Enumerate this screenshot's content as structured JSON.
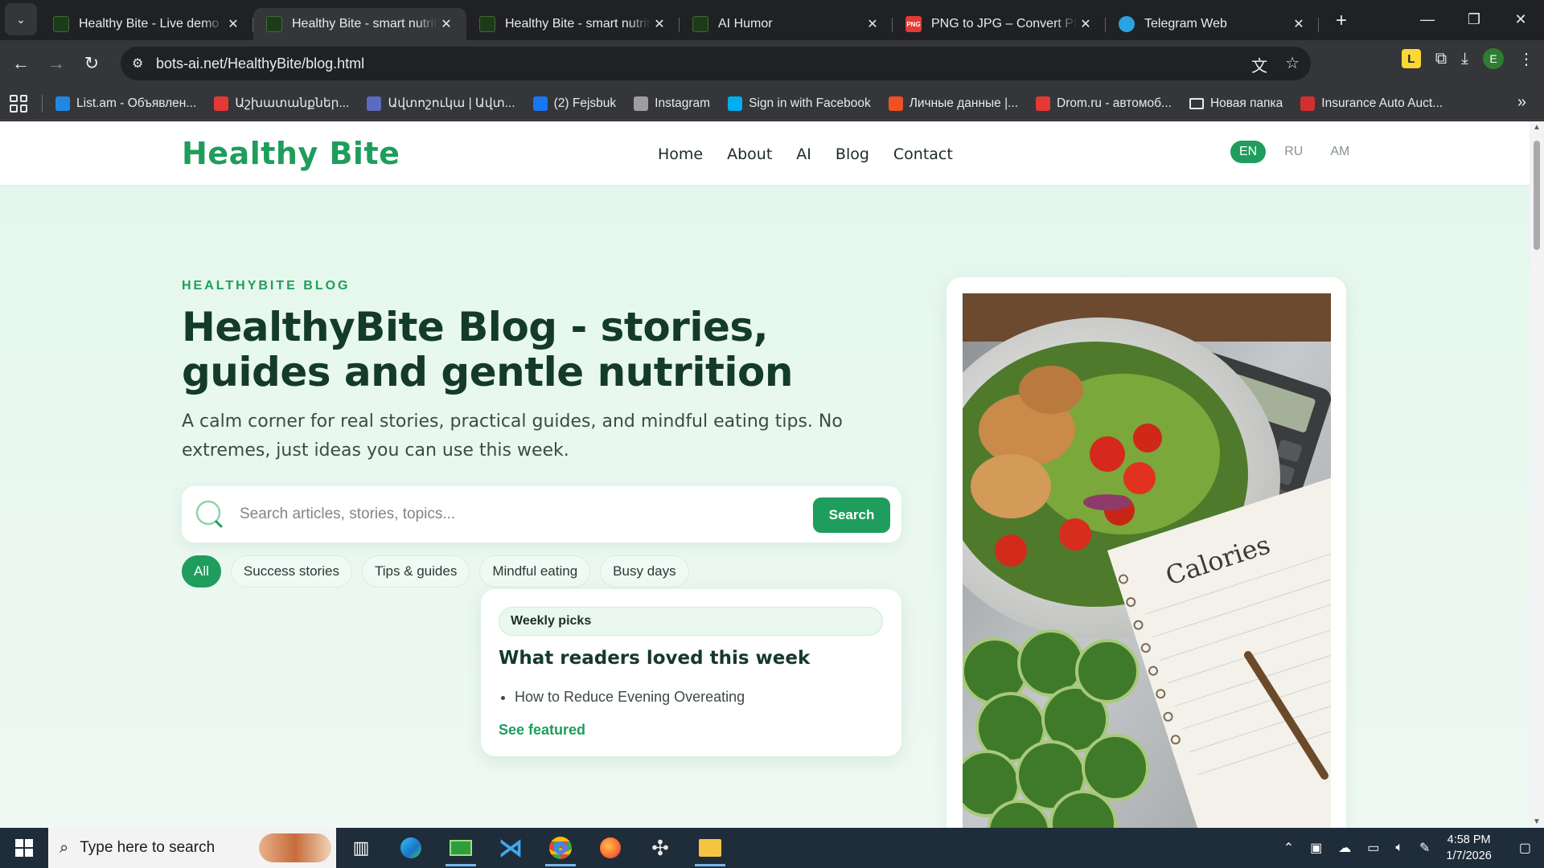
{
  "browser": {
    "tabs": [
      {
        "title": "Healthy Bite - Live demo | A",
        "icon": "leaf-favicon",
        "active": false
      },
      {
        "title": "Healthy Bite - smart nutritic",
        "icon": "leaf-favicon",
        "active": true
      },
      {
        "title": "Healthy Bite - smart nutritic",
        "icon": "leaf-favicon",
        "active": false
      },
      {
        "title": "AI Humor",
        "icon": "leaf-favicon",
        "active": false
      },
      {
        "title": "PNG to JPG – Convert PNG",
        "icon": "png-jpg-favicon",
        "active": false
      },
      {
        "title": "Telegram Web",
        "icon": "telegram-favicon",
        "active": false
      }
    ],
    "png_favicon_text": "PNG",
    "url": "bots-ai.net/HealthyBite/blog.html",
    "profile_initial": "E",
    "extension_letter": "L",
    "bookmarks": [
      {
        "label": "List.am - Объявлен...",
        "color": "#1e88e5"
      },
      {
        "label": "Աշխատանքներ...",
        "color": "#e53935"
      },
      {
        "label": "Ավտոշուկա | Ավտ...",
        "color": "#5c6bc0"
      },
      {
        "label": "(2) Fejsbuk",
        "color": "#1877f2"
      },
      {
        "label": "Instagram",
        "color": "#9e9e9e"
      },
      {
        "label": "Sign in with Facebook",
        "color": "#00aff0"
      },
      {
        "label": "Личные данные |...",
        "color": "#f25022"
      },
      {
        "label": "Drom.ru - автомоб...",
        "color": "#e53935"
      },
      {
        "label": "Новая папка",
        "color": "folder"
      },
      {
        "label": "Insurance Auto Auct...",
        "color": "#d32f2f"
      }
    ]
  },
  "site": {
    "logo": "Healthy Bite",
    "nav": [
      "Home",
      "About",
      "AI",
      "Blog",
      "Contact"
    ],
    "languages": [
      "EN",
      "RU",
      "AM"
    ],
    "active_language": "EN",
    "accent": "#1f9d5c",
    "heading_color": "#143a2b"
  },
  "hero": {
    "eyebrow": "HEALTHYBITE BLOG",
    "title": "HealthyBite Blog - stories, guides and gentle nutrition",
    "lead": "A calm corner for real stories, practical guides, and mindful eating tips. No extremes, just ideas you can use this week."
  },
  "search": {
    "placeholder": "Search articles, stories, topics...",
    "button": "Search"
  },
  "filters": [
    "All",
    "Success stories",
    "Tips & guides",
    "Mindful eating",
    "Busy days"
  ],
  "active_filter": "All",
  "weekly": {
    "badge": "Weekly picks",
    "title": "What readers loved this week",
    "items": [
      "How to Reduce Evening Overeating"
    ],
    "link": "See featured"
  },
  "hero_image": {
    "notebook_text": "Calories"
  },
  "taskbar": {
    "search_placeholder": "Type here to search",
    "time": "4:58 PM",
    "date": "1/7/2026"
  }
}
